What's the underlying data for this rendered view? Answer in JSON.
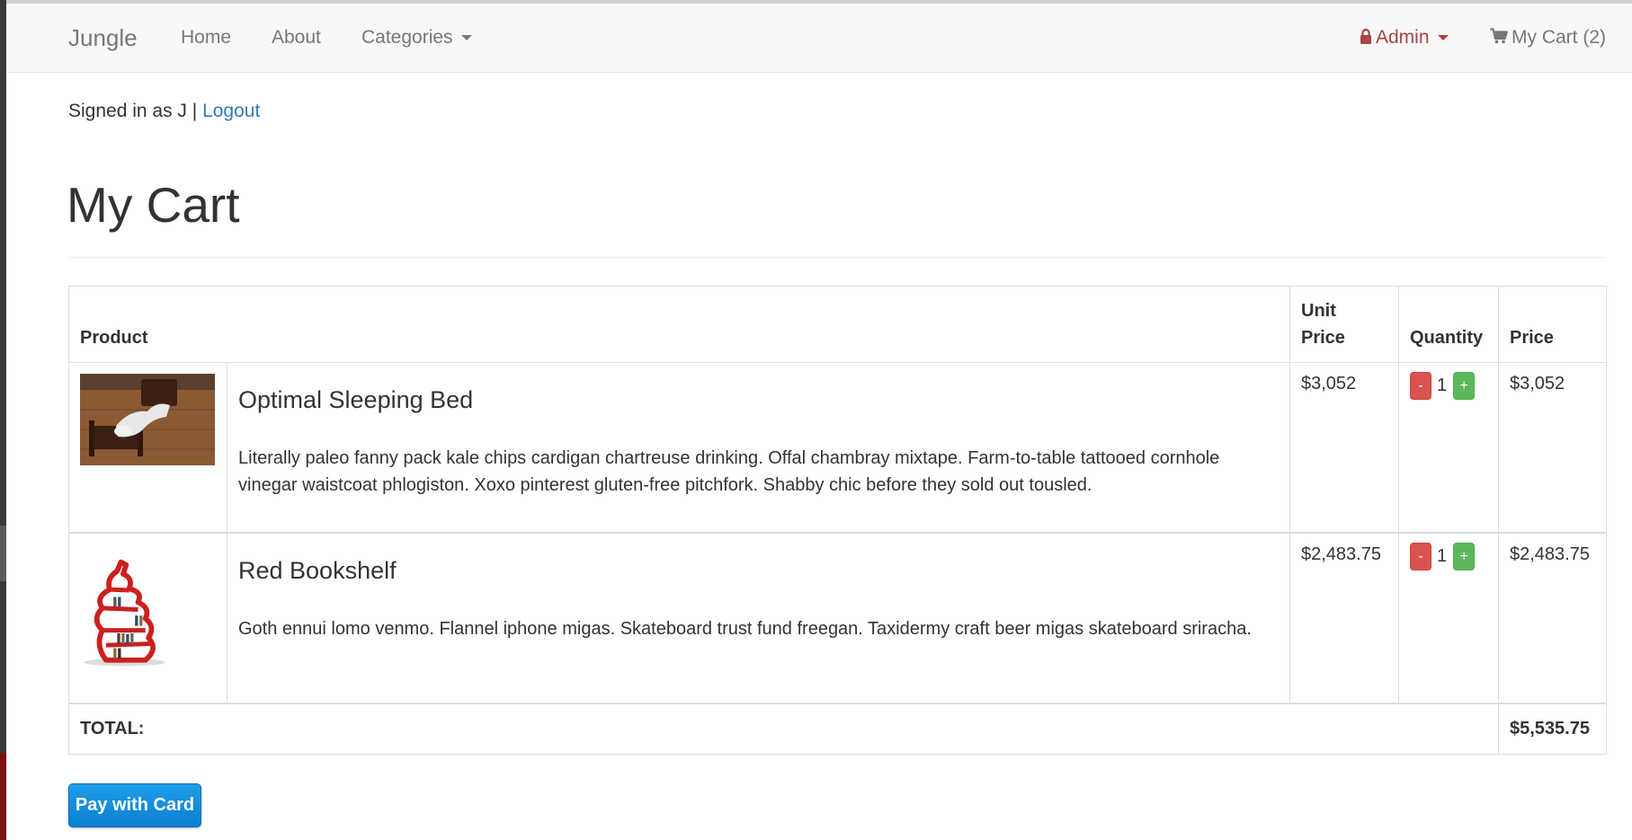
{
  "navbar": {
    "brand": "Jungle",
    "home": "Home",
    "about": "About",
    "categories": "Categories",
    "admin": "Admin",
    "cart": "My Cart (2)",
    "colors": {
      "background": "#f8f8f8",
      "link": "#777777",
      "admin": "#a94442"
    }
  },
  "session": {
    "signed_in_text": "Signed in as J |",
    "logout": "Logout"
  },
  "page": {
    "title": "My Cart"
  },
  "cart": {
    "headers": {
      "product": "Product",
      "unit_price_line1": "Unit",
      "unit_price_line2": "Price",
      "quantity": "Quantity",
      "price": "Price"
    },
    "items": [
      {
        "name": "Optimal Sleeping Bed",
        "description": "Literally paleo fanny pack kale chips cardigan chartreuse drinking. Offal chambray mixtape. Farm-to-table tattooed cornhole vinegar waistcoat phlogiston. Xoxo pinterest gluten-free pitchfork. Shabby chic before they sold out tousled.",
        "unit_price": "$3,052",
        "quantity": "1",
        "price": "$3,052",
        "image_icon": "bed-photo"
      },
      {
        "name": "Red Bookshelf",
        "description": "Goth ennui lomo venmo. Flannel iphone migas. Skateboard trust fund freegan. Taxidermy craft beer migas skateboard sriracha.",
        "unit_price": "$2,483.75",
        "quantity": "1",
        "price": "$2,483.75",
        "image_icon": "bookshelf-photo"
      }
    ],
    "minus_label": "-",
    "plus_label": "+",
    "total_label": "TOTAL:",
    "total_value": "$5,535.75",
    "colors": {
      "minus": "#d9534f",
      "plus": "#5cb85c"
    }
  },
  "checkout": {
    "pay_button": "Pay with Card",
    "color": "#1f9ee7"
  }
}
